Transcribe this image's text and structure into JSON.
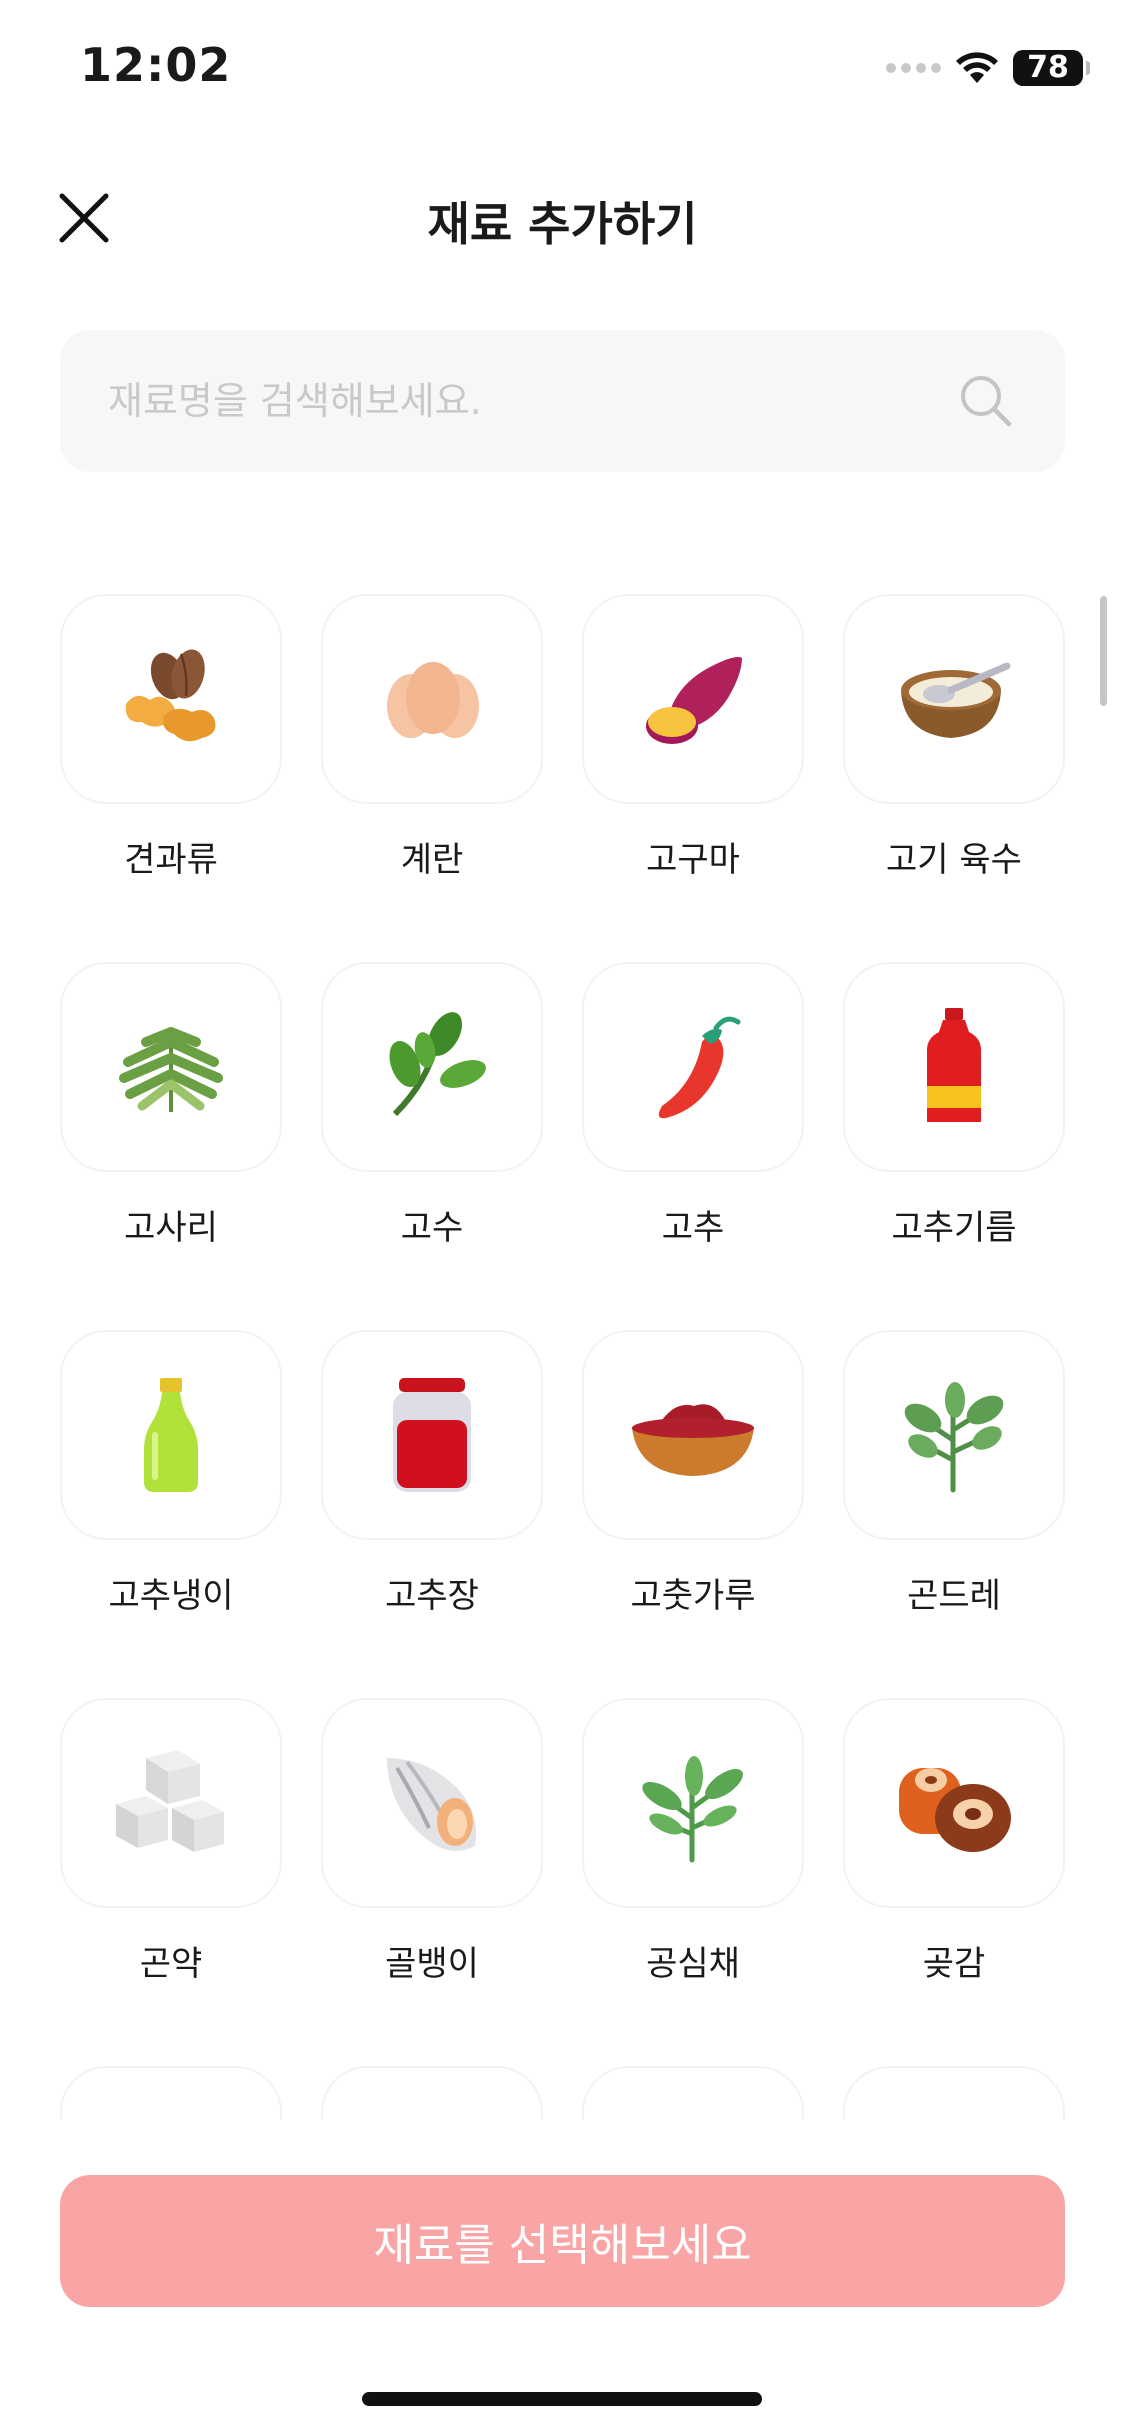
{
  "status_bar": {
    "time": "12:02",
    "battery": "78"
  },
  "header": {
    "title": "재료 추가하기"
  },
  "search": {
    "placeholder": "재료명을 검색해보세요."
  },
  "ingredients": [
    {
      "label": "견과류",
      "icon": "nuts-icon"
    },
    {
      "label": "계란",
      "icon": "egg-icon"
    },
    {
      "label": "고구마",
      "icon": "sweet-potato-icon"
    },
    {
      "label": "고기 육수",
      "icon": "broth-bowl-icon"
    },
    {
      "label": "고사리",
      "icon": "fern-icon"
    },
    {
      "label": "고수",
      "icon": "coriander-icon"
    },
    {
      "label": "고추",
      "icon": "chili-pepper-icon"
    },
    {
      "label": "고추기름",
      "icon": "chili-oil-bottle-icon"
    },
    {
      "label": "고추냉이",
      "icon": "wasabi-tube-icon"
    },
    {
      "label": "고추장",
      "icon": "gochujang-jar-icon"
    },
    {
      "label": "고춧가루",
      "icon": "chili-powder-bowl-icon"
    },
    {
      "label": "곤드레",
      "icon": "gondre-herb-icon"
    },
    {
      "label": "곤약",
      "icon": "konjac-cubes-icon"
    },
    {
      "label": "골뱅이",
      "icon": "sea-snail-icon"
    },
    {
      "label": "공심채",
      "icon": "water-spinach-icon"
    },
    {
      "label": "곶감",
      "icon": "dried-persimmon-icon"
    }
  ],
  "colors": {
    "cta_background": "#f9a5a5",
    "tile_border": "#f2f2f2",
    "search_background": "#f7f7f7"
  },
  "cta": {
    "label": "재료를 선택해보세요"
  }
}
